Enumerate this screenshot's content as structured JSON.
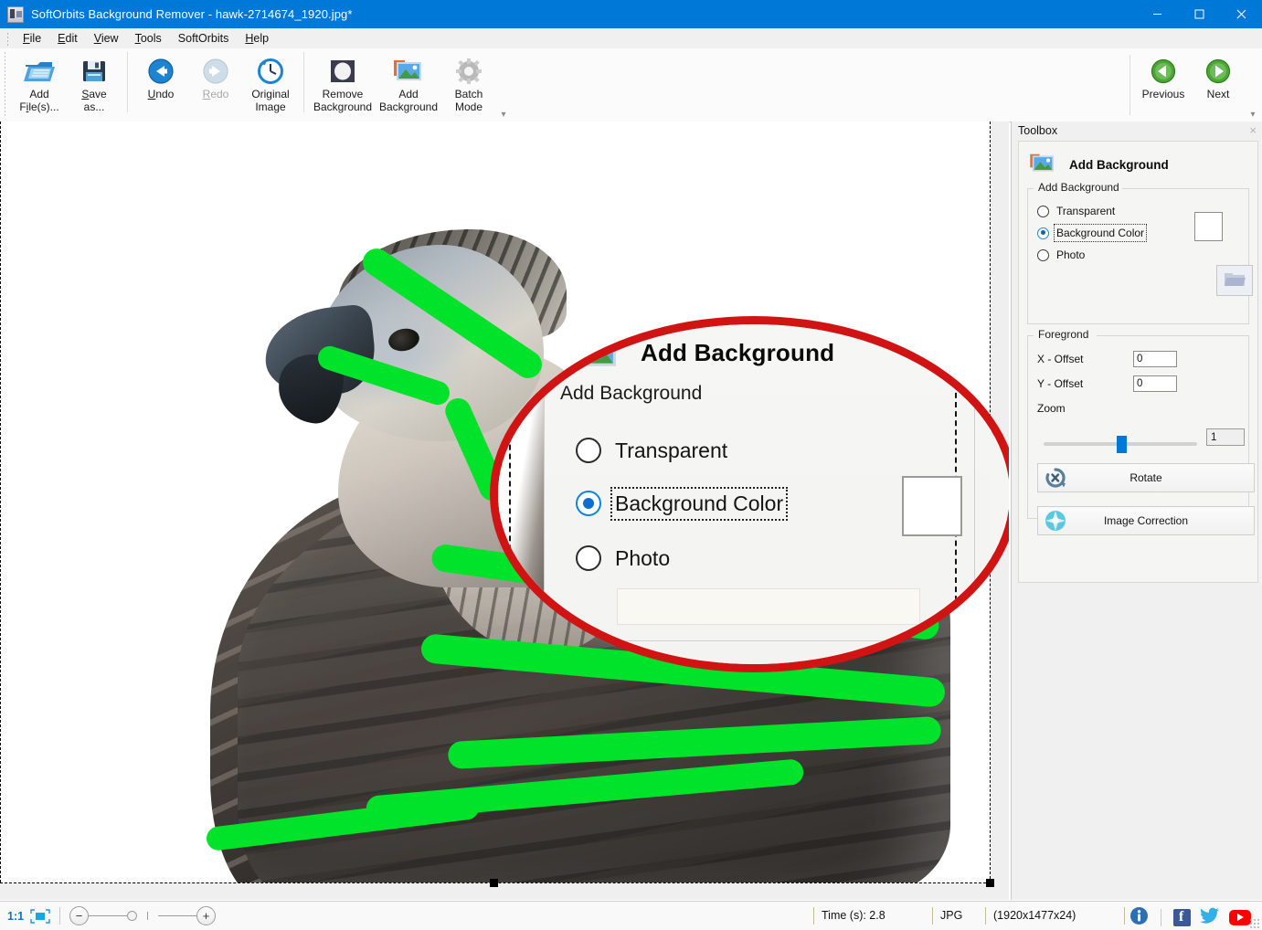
{
  "window": {
    "title": "SoftOrbits Background Remover - hawk-2714674_1920.jpg*",
    "app_icon": "app-icon",
    "minimize": "minimize",
    "maximize": "maximize",
    "close": "close",
    "accent_color": "#0078d7"
  },
  "menubar": {
    "items": [
      {
        "label": "File",
        "accel": "F"
      },
      {
        "label": "Edit",
        "accel": "E"
      },
      {
        "label": "View",
        "accel": "V"
      },
      {
        "label": "Tools",
        "accel": "T"
      },
      {
        "label": "SoftOrbits",
        "accel": ""
      },
      {
        "label": "Help",
        "accel": "H"
      }
    ]
  },
  "ribbon": {
    "groups": [
      {
        "buttons": [
          {
            "label": "Add\nFile(s)...",
            "icon": "add-files-icon",
            "enabled": true
          },
          {
            "label": "Save\nas...",
            "icon": "save-as-icon",
            "enabled": true
          }
        ]
      },
      {
        "buttons": [
          {
            "label": "Undo",
            "icon": "undo-icon",
            "enabled": true
          },
          {
            "label": "Redo",
            "icon": "redo-icon",
            "enabled": false
          },
          {
            "label": "Original\nImage",
            "icon": "original-image-icon",
            "enabled": true
          }
        ]
      },
      {
        "buttons": [
          {
            "label": "Remove\nBackground",
            "icon": "remove-background-icon",
            "enabled": true
          },
          {
            "label": "Add\nBackground",
            "icon": "add-background-icon",
            "enabled": true
          },
          {
            "label": "Batch\nMode",
            "icon": "batch-mode-icon",
            "enabled": true
          }
        ]
      }
    ],
    "navigation": [
      {
        "label": "Previous",
        "icon": "previous-arrow-icon"
      },
      {
        "label": "Next",
        "icon": "next-arrow-icon"
      }
    ],
    "expand_glyph": "▾"
  },
  "toolbox": {
    "header": "Toolbox",
    "close_glyph": "×",
    "panel_title": "Add Background",
    "panel_icon": "add-background-icon",
    "add_background_group": {
      "legend": "Add Background",
      "options": [
        {
          "label": "Transparent",
          "selected": false,
          "focused": false
        },
        {
          "label": "Background Color",
          "selected": true,
          "focused": true
        },
        {
          "label": "Photo",
          "selected": false,
          "focused": false
        }
      ],
      "color_swatch": "#ffffff",
      "browse_icon": "folder-open-icon"
    },
    "foreground_group": {
      "legend": "Foregrond",
      "x_offset_label": "X - Offset",
      "x_offset_value": "0",
      "y_offset_label": "Y - Offset",
      "y_offset_value": "0",
      "zoom_label": "Zoom",
      "zoom_value": "1",
      "zoom_slider_percent": 48
    },
    "buttons": [
      {
        "label": "Rotate",
        "icon": "rotate-icon"
      },
      {
        "label": "Image Correction",
        "icon": "image-correction-icon"
      }
    ]
  },
  "canvas": {
    "image_name": "hawk-2714674_1920.jpg",
    "marker_color": "#00e32a",
    "selection_handles": 3,
    "callout": {
      "ring_color": "#d01414",
      "title": "Add Background",
      "title_icon": "add-background-icon",
      "legend": "Add Background",
      "options": [
        {
          "label": "Transparent",
          "selected": false,
          "focused": false
        },
        {
          "label": "Background Color",
          "selected": true,
          "focused": true
        },
        {
          "label": "Photo",
          "selected": false,
          "focused": false
        }
      ],
      "color_swatch": "#ffffff"
    }
  },
  "statusbar": {
    "zoom_ratio": "1:1",
    "fit_icon": "fit-to-screen-icon",
    "zoom_out_glyph": "−",
    "zoom_in_glyph": "+",
    "time_label": "Time (s): 2.8",
    "format_label": "JPG",
    "dimensions_label": "(1920x1477x24)",
    "social": [
      {
        "name": "info-icon"
      },
      {
        "name": "facebook-icon"
      },
      {
        "name": "twitter-icon"
      },
      {
        "name": "youtube-icon"
      }
    ]
  }
}
